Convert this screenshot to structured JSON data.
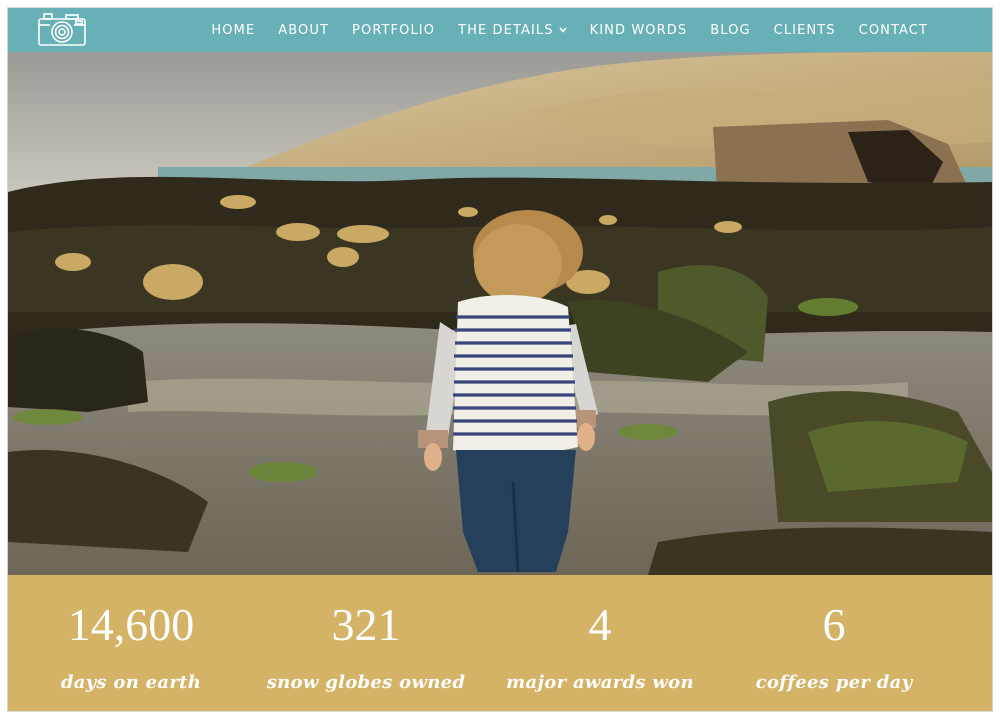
{
  "nav": {
    "logo_icon": "camera-icon",
    "items": [
      {
        "label": "HOME"
      },
      {
        "label": "ABOUT"
      },
      {
        "label": "PORTFOLIO"
      },
      {
        "label": "THE DETAILS",
        "has_dropdown": true
      },
      {
        "label": "KIND WORDS"
      },
      {
        "label": "BLOG"
      },
      {
        "label": "CLIENTS"
      },
      {
        "label": "CONTACT"
      }
    ]
  },
  "colors": {
    "nav_bg": "#67b0b6",
    "stats_bg": "#d4b266",
    "text": "#ffffff"
  },
  "stats": [
    {
      "number": "14,600",
      "label": "days on earth"
    },
    {
      "number": "321",
      "label": "snow globes owned"
    },
    {
      "number": "4",
      "label": "major awards won"
    },
    {
      "number": "6",
      "label": "coffees per day"
    }
  ]
}
